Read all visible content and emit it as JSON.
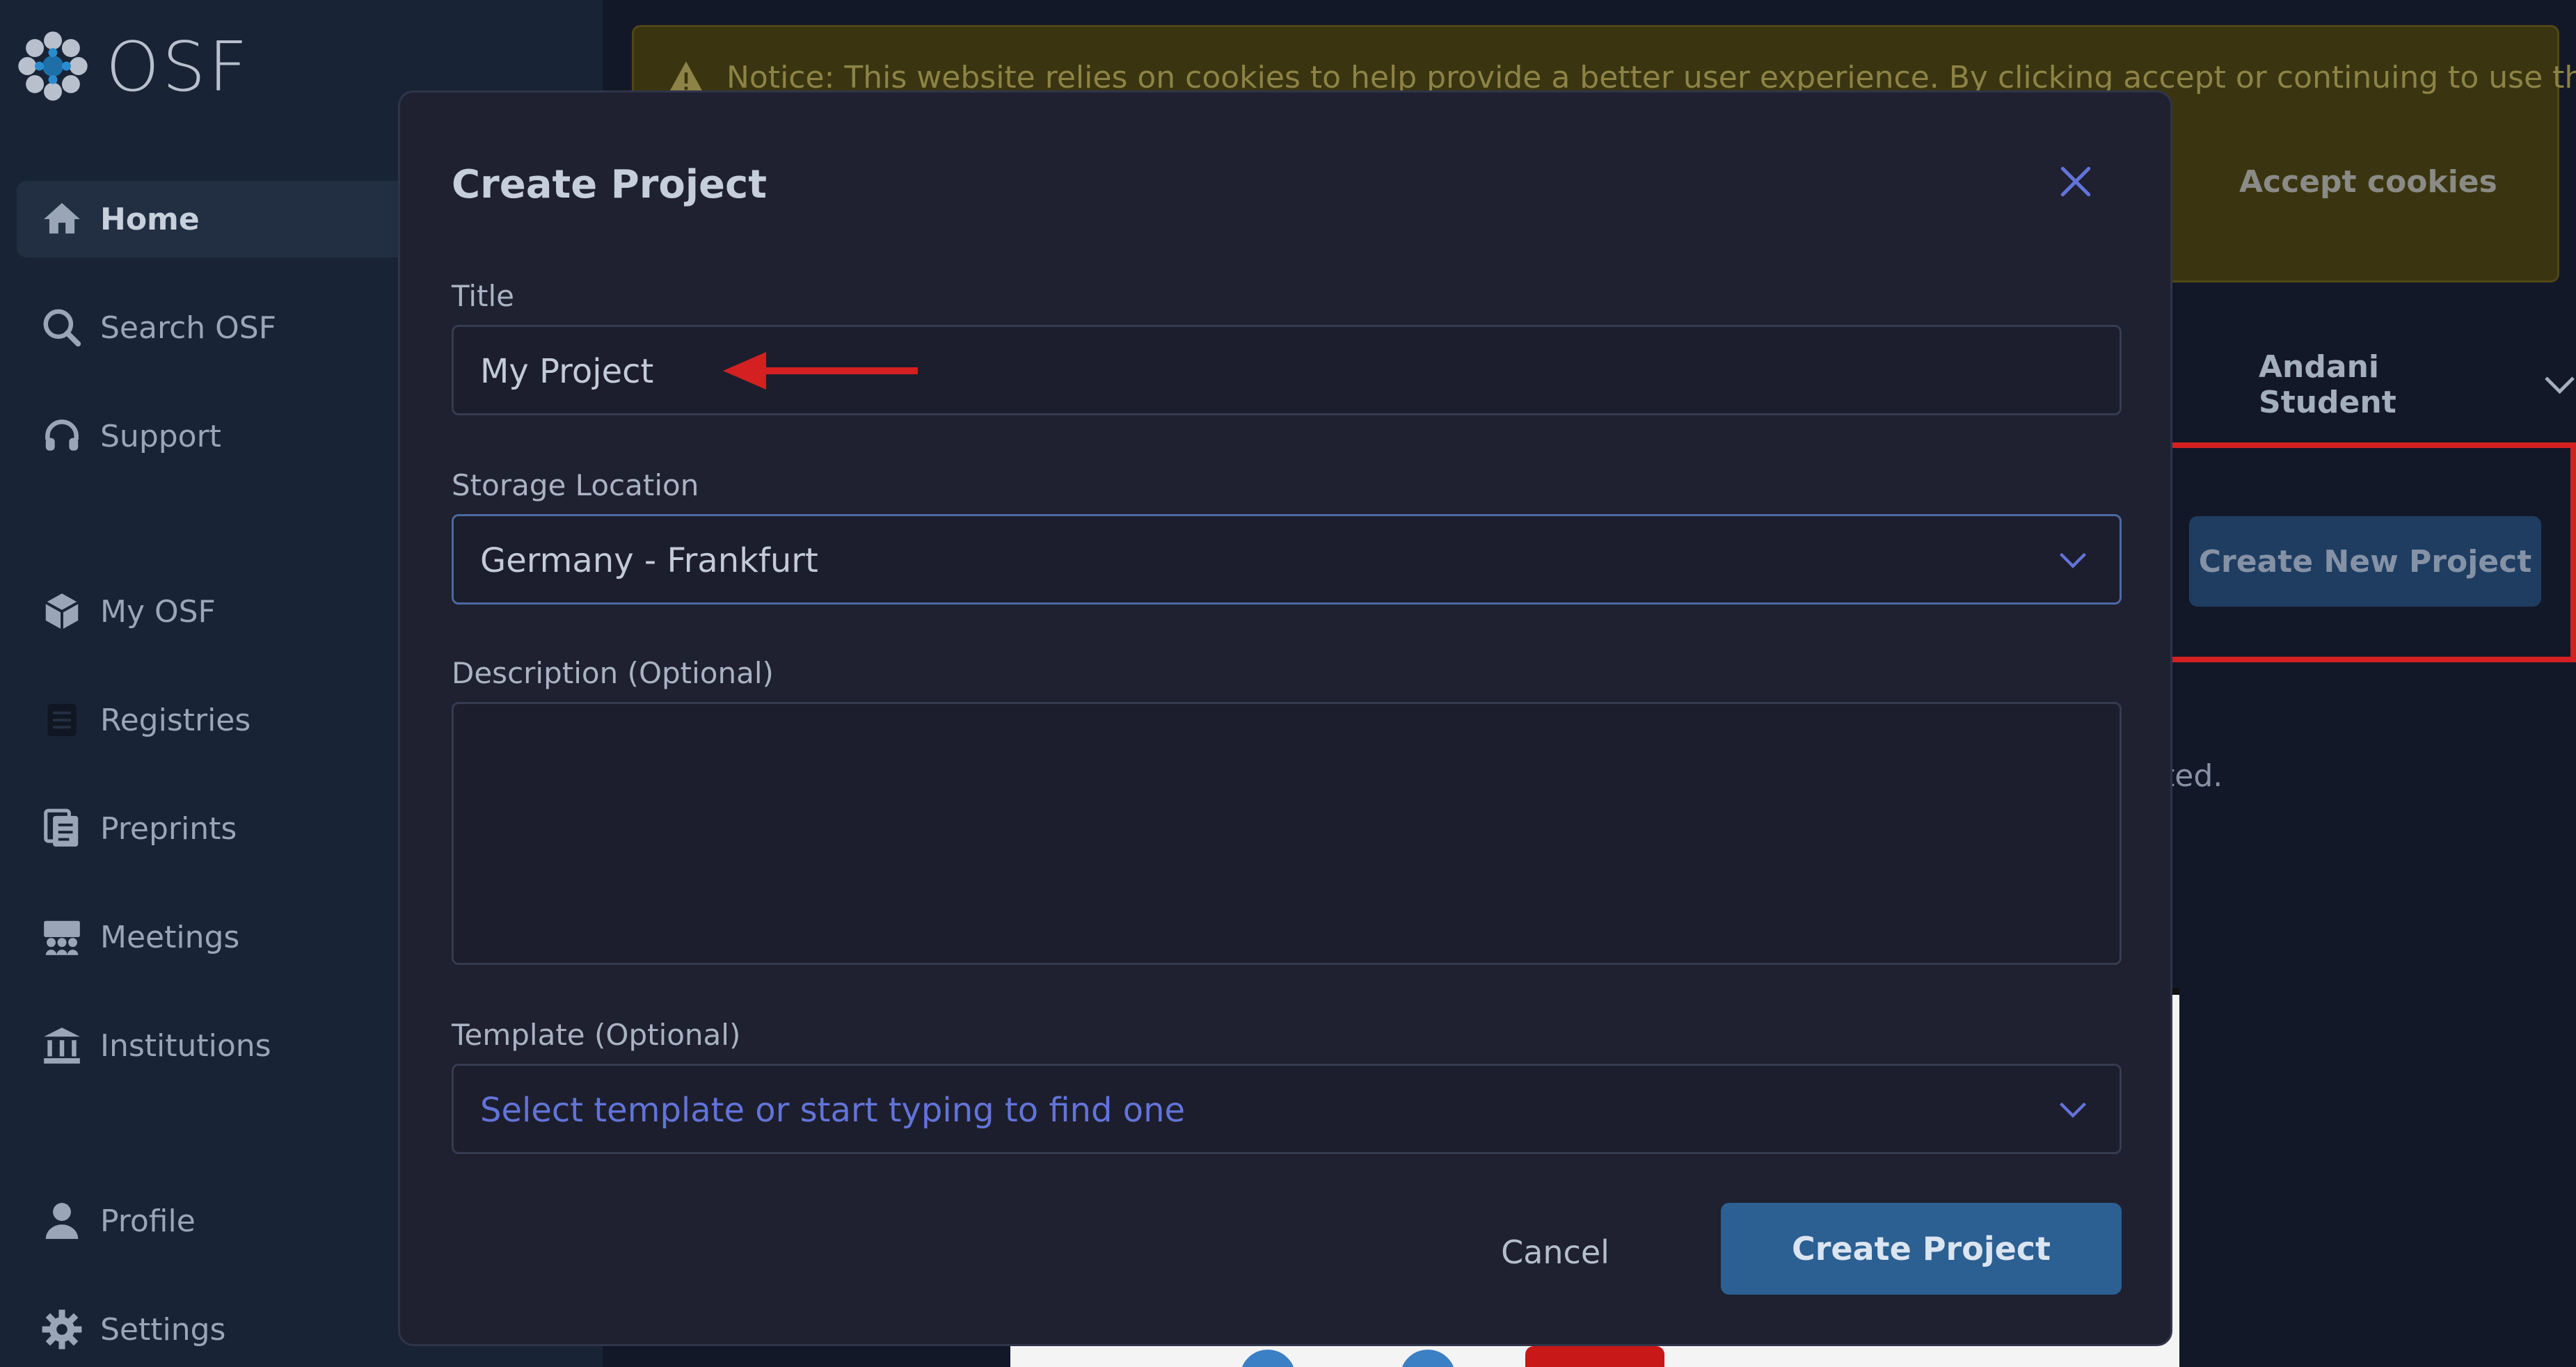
{
  "brand": {
    "name": "OSF",
    "logo_icon": "osf-logo-icon"
  },
  "sidebar": {
    "items": [
      {
        "label": "Home",
        "icon": "home-icon",
        "active": true
      },
      {
        "label": "Search OSF",
        "icon": "search-icon",
        "active": false
      },
      {
        "label": "Support",
        "icon": "headset-icon",
        "active": false
      },
      {
        "label": "My OSF",
        "icon": "cube-icon",
        "active": false
      },
      {
        "label": "Registries",
        "icon": "registries-icon",
        "active": false
      },
      {
        "label": "Preprints",
        "icon": "preprints-icon",
        "active": false
      },
      {
        "label": "Meetings",
        "icon": "meetings-icon",
        "active": false
      },
      {
        "label": "Institutions",
        "icon": "institution-icon",
        "active": false
      },
      {
        "label": "Profile",
        "icon": "user-icon",
        "active": false
      },
      {
        "label": "Settings",
        "icon": "gear-icon",
        "active": false
      }
    ]
  },
  "background": {
    "cookie_notice": "Notice: This website relies on cookies to help provide a better user experience. By clicking accept or continuing to use the site,",
    "accept_cookies": "Accept cookies",
    "user_name": "Andani Student",
    "create_new_project": "Create New Project",
    "partial_text": "ted."
  },
  "modal": {
    "title": "Create Project",
    "close_icon": "close-icon",
    "title_field": {
      "label": "Title",
      "value": "My Project"
    },
    "storage_field": {
      "label": "Storage Location",
      "value": "Germany - Frankfurt"
    },
    "description_field": {
      "label": "Description (Optional)",
      "value": ""
    },
    "template_field": {
      "label": "Template (Optional)",
      "placeholder": "Select template or start typing to find one"
    },
    "cancel_label": "Cancel",
    "create_label": "Create Project"
  },
  "colors": {
    "accent": "#6274d9",
    "primary_button": "#2c5f92",
    "annotation_red": "#d42020",
    "sidebar_bg": "#182436",
    "modal_bg": "#1f2030"
  }
}
